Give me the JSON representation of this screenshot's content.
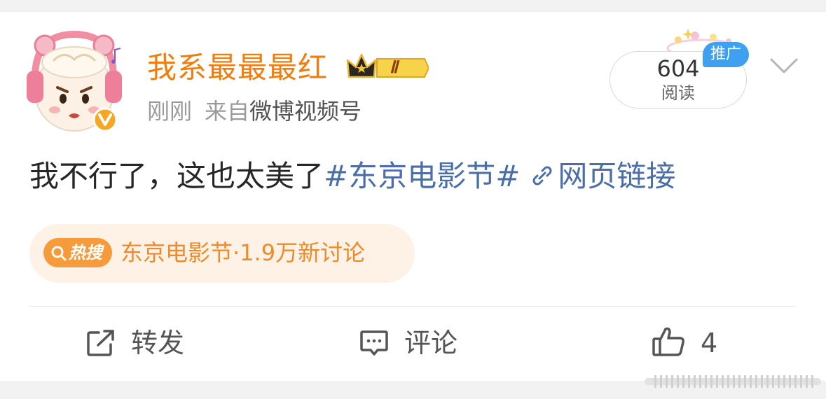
{
  "post": {
    "username": "我系最最最红",
    "time": "刚刚",
    "source_prefix": "来自",
    "source": "微博视频号",
    "reads": {
      "count": "604",
      "label": "阅读"
    },
    "promo_tag": "推广",
    "member_level_badge": "Ⅱ",
    "content": {
      "text": "我不行了，这也太美了",
      "topic": "#东京电影节#",
      "link_text": "网页链接"
    },
    "hot_search": {
      "badge": "热搜",
      "text": "东京电影节·1.9万新讨论"
    },
    "actions": {
      "repost_label": "转发",
      "comment_label": "评论",
      "like_count": "4"
    }
  },
  "colors": {
    "username": "#f07d0c",
    "topic_link": "#4a6ea8",
    "hot_badge": "#f59b3c",
    "hot_pill_bg": "#fef2e7",
    "promo_tag": "#3ea0ee",
    "verified_badge": "#f5a623"
  },
  "icons": {
    "avatar": "sheep-with-headphones-avatar",
    "verified": "verified-v-icon",
    "member": "crown-icon",
    "link": "link-icon",
    "hot_search": "search-icon",
    "more": "chevron-down-icon",
    "repost": "share-arrow-icon",
    "comment": "comment-bubble-icon",
    "like": "thumbs-up-icon"
  }
}
